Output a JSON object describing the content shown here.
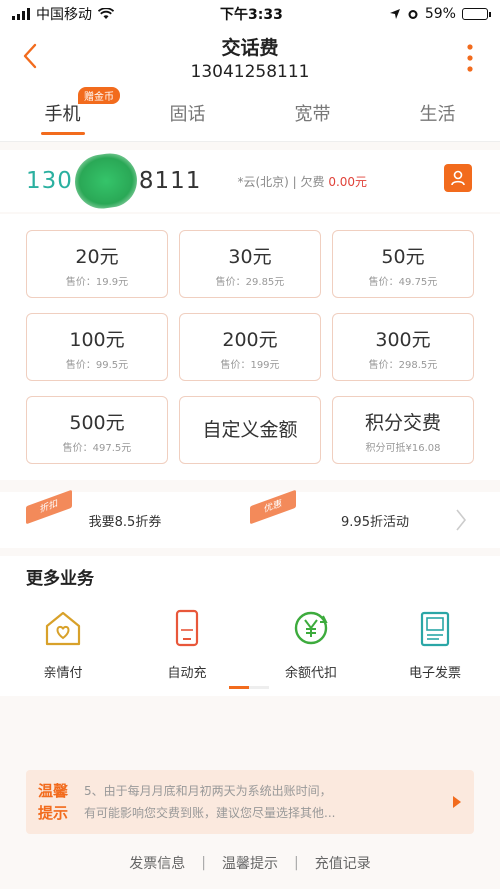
{
  "status_bar": {
    "carrier": "中国移动",
    "time": "下午3:33",
    "battery": "59%",
    "battery_level": 0.59
  },
  "nav": {
    "title": "交话费",
    "phone": "13041258111"
  },
  "tabs": [
    {
      "label": "手机",
      "active": true,
      "badge": "赠金币"
    },
    {
      "label": "固话",
      "active": false
    },
    {
      "label": "宽带",
      "active": false
    },
    {
      "label": "生活",
      "active": false
    }
  ],
  "phone_row": {
    "prefix": "130",
    "suffix": "8111",
    "info_prefix": "*云(北京) | 欠费",
    "owe": "0.00元"
  },
  "amounts": [
    {
      "value": "20元",
      "price": "售价：19.9元"
    },
    {
      "value": "30元",
      "price": "售价：29.85元"
    },
    {
      "value": "50元",
      "price": "售价：49.75元"
    },
    {
      "value": "100元",
      "price": "售价：99.5元"
    },
    {
      "value": "200元",
      "price": "售价：199元"
    },
    {
      "value": "300元",
      "price": "售价：298.5元"
    },
    {
      "value": "500元",
      "price": "售价：497.5元"
    },
    {
      "value": "自定义金额",
      "price": ""
    },
    {
      "value": "积分交费",
      "price": "积分可抵¥16.08"
    }
  ],
  "promos": [
    {
      "tag": "折扣",
      "label": "我要8.5折券"
    },
    {
      "tag": "优惠",
      "label": "9.95折活动"
    }
  ],
  "more_services": {
    "title": "更多业务",
    "items": [
      {
        "label": "亲情付",
        "icon": "house-heart-icon"
      },
      {
        "label": "自动充",
        "icon": "phone-auto-icon"
      },
      {
        "label": "余额代扣",
        "icon": "yen-cycle-icon"
      },
      {
        "label": "电子发票",
        "icon": "invoice-icon"
      }
    ]
  },
  "tip": {
    "tag_line1": "温馨",
    "tag_line2": "提示",
    "text_line1": "5、由于每月月底和月初两天为系统出账时间，",
    "text_line2": "有可能影响您交费到账，建议您尽量选择其他..."
  },
  "footer": {
    "link1": "发票信息",
    "link2": "温馨提示",
    "link3": "充值记录"
  },
  "colors": {
    "accent": "#f26b1d",
    "owe": "#e0433a"
  }
}
